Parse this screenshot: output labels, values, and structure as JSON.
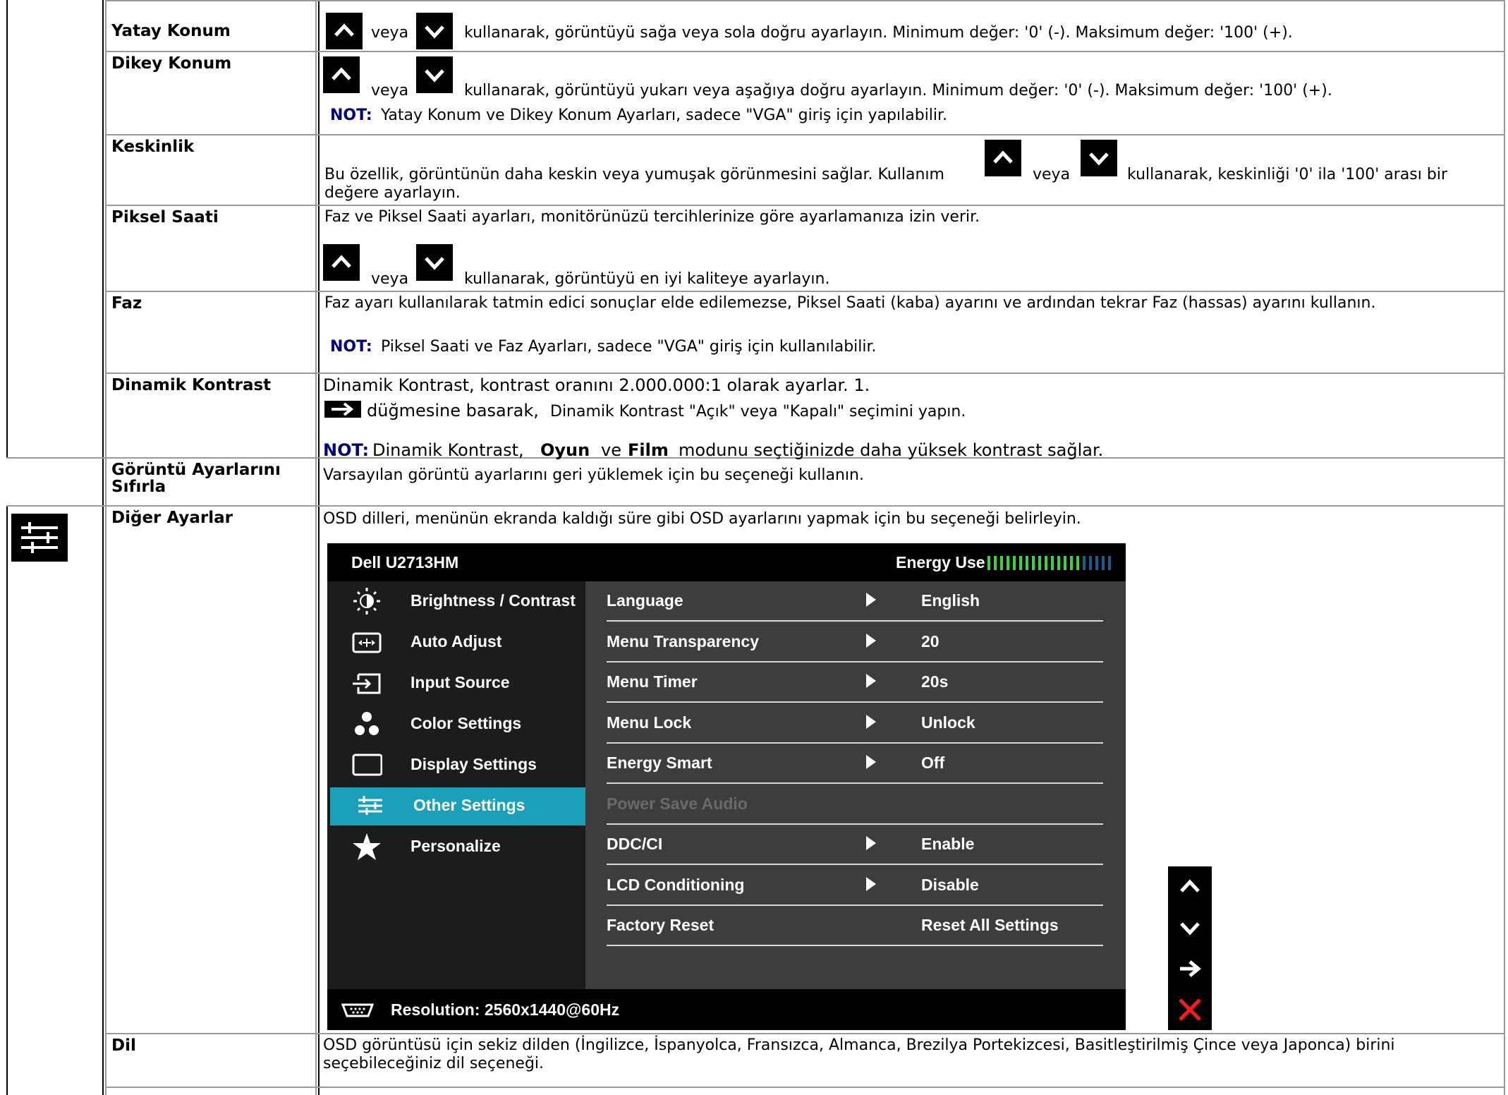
{
  "rows": [
    {
      "label": "Yatay Konum"
    },
    {
      "label": "Dikey Konum"
    },
    {
      "label": "Keskinlik"
    },
    {
      "label": "Piksel Saati"
    },
    {
      "label": "Faz"
    },
    {
      "label": "Dinamik Kontrast"
    },
    {
      "label": "Görüntü Ayarlarını Sıfırla"
    },
    {
      "label": "Diğer Ayarlar"
    },
    {
      "label": "Dil"
    }
  ],
  "yatay": {
    "veya": "veya",
    "rest": "kullanarak, görüntüyü sağa veya sola doğru ayarlayın. Minimum değer: '0' (-). Maksimum değer: '100' (+)."
  },
  "dikey": {
    "veya": "veya",
    "rest": "kullanarak, görüntüyü yukarı veya aşağıya doğru ayarlayın. Minimum değer: '0' (-). Maksimum değer: '100' (+).",
    "note_label": "NOT:",
    "note": "Yatay Konum ve Dikey Konum Ayarları, sadece \"VGA\" giriş için yapılabilir."
  },
  "keskinlik": {
    "pre": "Bu özellik, görüntünün daha keskin veya yumuşak görünmesini sağlar. Kullanım",
    "veya": "veya",
    "post": "kullanarak, keskinliği '0' ila '100' arası bir",
    "line2": "değere ayarlayın."
  },
  "piksel": {
    "line1": "Faz ve Piksel Saati ayarları, monitörünüzü tercihlerinize göre ayarlamanıza izin verir.",
    "veya": "veya",
    "rest": "kullanarak, görüntüyü en iyi kaliteye ayarlayın."
  },
  "faz": {
    "line1": "Faz ayarı kullanılarak tatmin edici sonuçlar elde edilemezse, Piksel Saati (kaba) ayarını ve ardından tekrar Faz (hassas) ayarını kullanın.",
    "note_label": "NOT:",
    "note": "Piksel Saati ve Faz Ayarları, sadece \"VGA\" giriş için kullanılabilir."
  },
  "dinamik": {
    "line1": "Dinamik Kontrast, kontrast oranını 2.000.000:1 olarak ayarlar. 1.",
    "line2a": "düğmesine basarak,",
    "line2b": "Dinamik Kontrast \"Açık\" veya \"Kapalı\" seçimini yapın.",
    "note_label": "NOT:",
    "note_a": "Dinamik Kontrast,",
    "note_b1": "Oyun",
    "note_b2": "ve",
    "note_b3": "Film",
    "note_c": "modunu seçtiğinizde daha yüksek kontrast sağlar."
  },
  "sifirla": {
    "line1": "Varsayılan görüntü ayarlarını geri yüklemek için bu seçeneği kullanın."
  },
  "diger": {
    "line1": "OSD dilleri, menünün ekranda kaldığı süre gibi OSD ayarlarını yapmak için bu seçeneği belirleyin."
  },
  "dil": {
    "line1": "OSD görüntüsü için sekiz dilden (İngilizce, İspanyolca, Fransızca, Almanca, Brezilya Portekizcesi, Basitleştirilmiş Çince veya Japonca) birini",
    "line2": "seçebileceğiniz dil seçeneği."
  },
  "osd": {
    "model": "Dell U2713HM",
    "energy_label": "Energy Use",
    "energy_level": 0.75,
    "menu": [
      {
        "label": "Brightness / Contrast",
        "icon": "brightness-icon"
      },
      {
        "label": "Auto Adjust",
        "icon": "auto-adjust-icon"
      },
      {
        "label": "Input Source",
        "icon": "input-source-icon"
      },
      {
        "label": "Color Settings",
        "icon": "color-settings-icon"
      },
      {
        "label": "Display Settings",
        "icon": "display-settings-icon"
      },
      {
        "label": "Other Settings",
        "icon": "other-settings-icon",
        "active": true
      },
      {
        "label": "Personalize",
        "icon": "star-icon"
      }
    ],
    "settings": [
      {
        "label": "Language",
        "value": "English",
        "arrow": true
      },
      {
        "label": "Menu Transparency",
        "value": "20",
        "arrow": true
      },
      {
        "label": "Menu Timer",
        "value": "20s",
        "arrow": true
      },
      {
        "label": "Menu Lock",
        "value": "Unlock",
        "arrow": true
      },
      {
        "label": "Energy Smart",
        "value": "Off",
        "arrow": true
      },
      {
        "label": "Power Save Audio",
        "value": "",
        "arrow": false,
        "disabled": true
      },
      {
        "label": "DDC/CI",
        "value": "Enable",
        "arrow": true
      },
      {
        "label": "LCD Conditioning",
        "value": "Disable",
        "arrow": true
      },
      {
        "label": "Factory Reset",
        "value": "Reset All Settings",
        "arrow": false
      }
    ],
    "resolution": "Resolution: 2560x1440@60Hz",
    "accent_color": "#1aa0b8"
  }
}
